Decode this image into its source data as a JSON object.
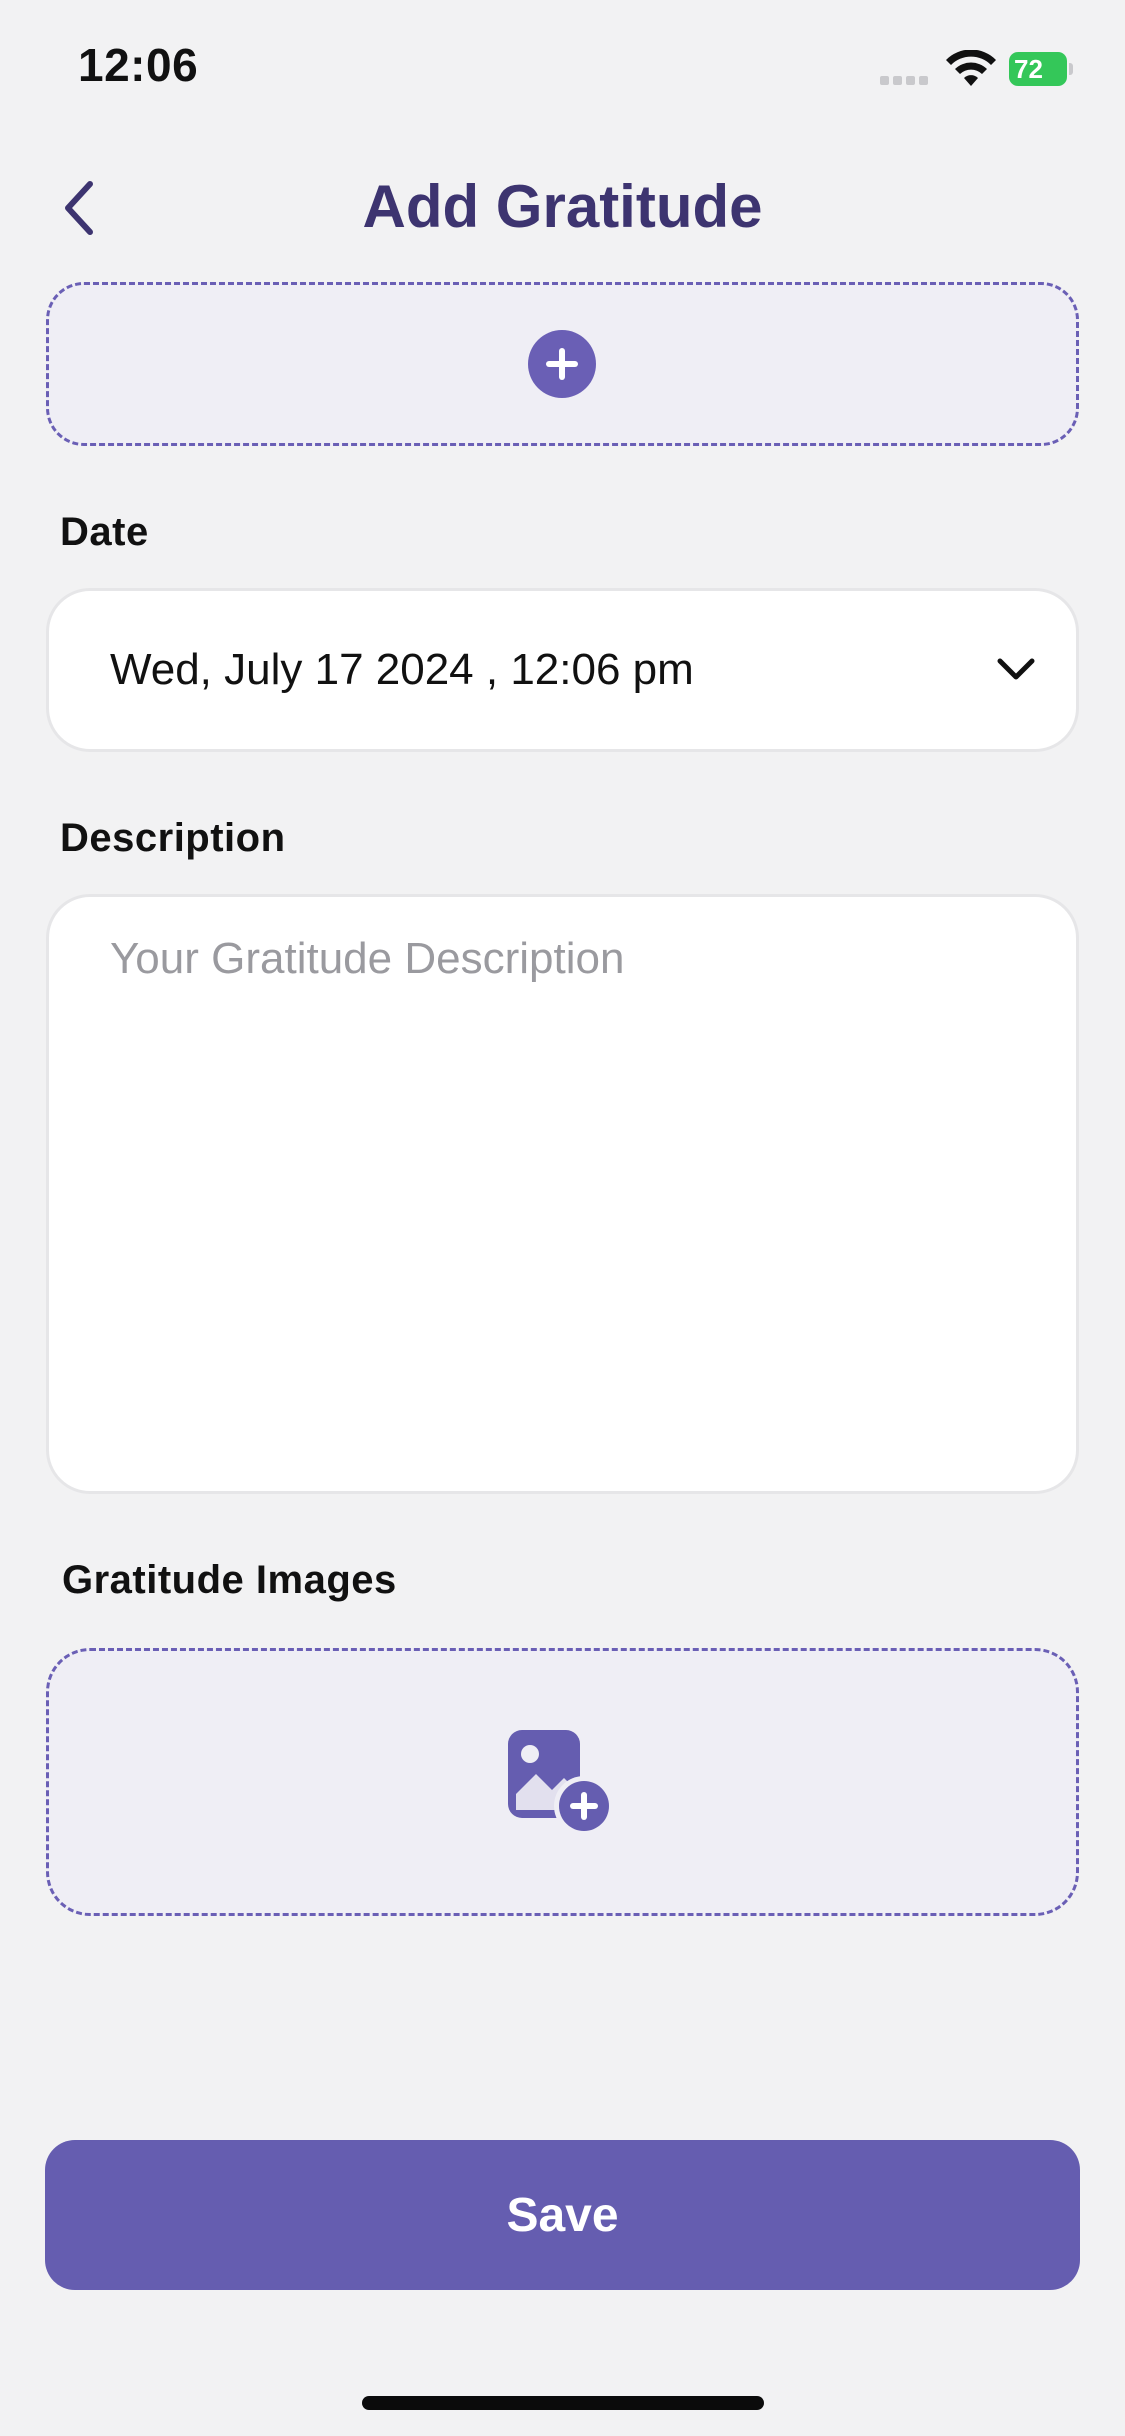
{
  "status_bar": {
    "time": "12:06",
    "battery": "72"
  },
  "header": {
    "title": "Add Gratitude"
  },
  "form": {
    "date_label": "Date",
    "date_value": "Wed, July 17 2024 , 12:06 pm",
    "description_label": "Description",
    "description_placeholder": "Your Gratitude Description",
    "images_label": "Gratitude Images"
  },
  "actions": {
    "save_label": "Save"
  },
  "colors": {
    "accent": "#655db0",
    "title": "#3d3470",
    "battery": "#34c759"
  }
}
